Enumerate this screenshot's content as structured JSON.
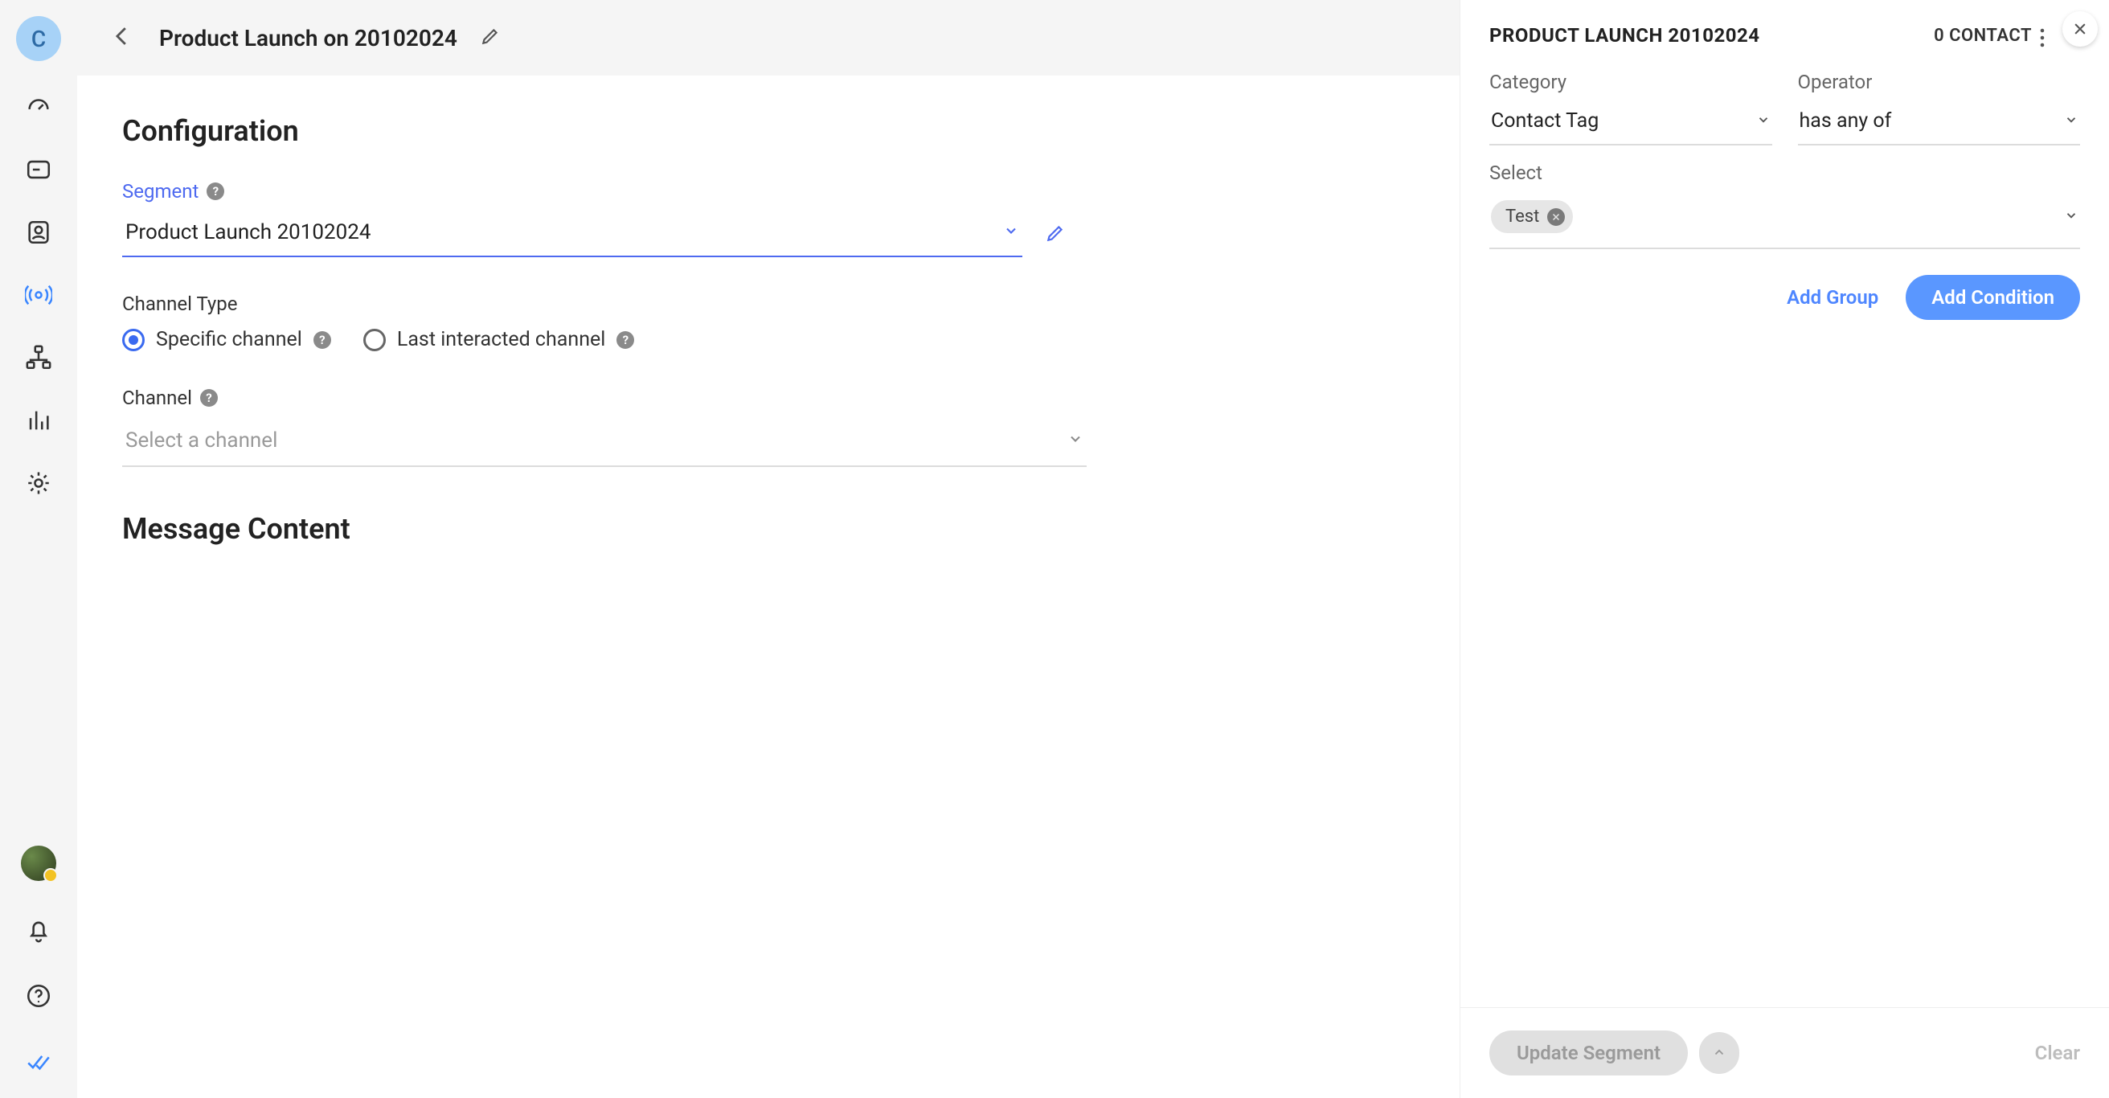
{
  "sidebar": {
    "org_initial": "C"
  },
  "topbar": {
    "title": "Product Launch on 20102024"
  },
  "config": {
    "heading": "Configuration",
    "segment_label": "Segment",
    "segment_value": "Product Launch 20102024",
    "channel_type_label": "Channel Type",
    "radio_specific": "Specific channel",
    "radio_last": "Last interacted channel",
    "channel_label": "Channel",
    "channel_placeholder": "Select a channel",
    "message_heading": "Message Content"
  },
  "panel": {
    "title": "PRODUCT LAUNCH 20102024",
    "contact_count": "0 CONTACT",
    "category_label": "Category",
    "category_value": "Contact Tag",
    "operator_label": "Operator",
    "operator_value": "has any of",
    "select_label": "Select",
    "tags": [
      "Test"
    ],
    "add_group": "Add Group",
    "add_condition": "Add Condition",
    "update_btn": "Update Segment",
    "clear_btn": "Clear"
  }
}
